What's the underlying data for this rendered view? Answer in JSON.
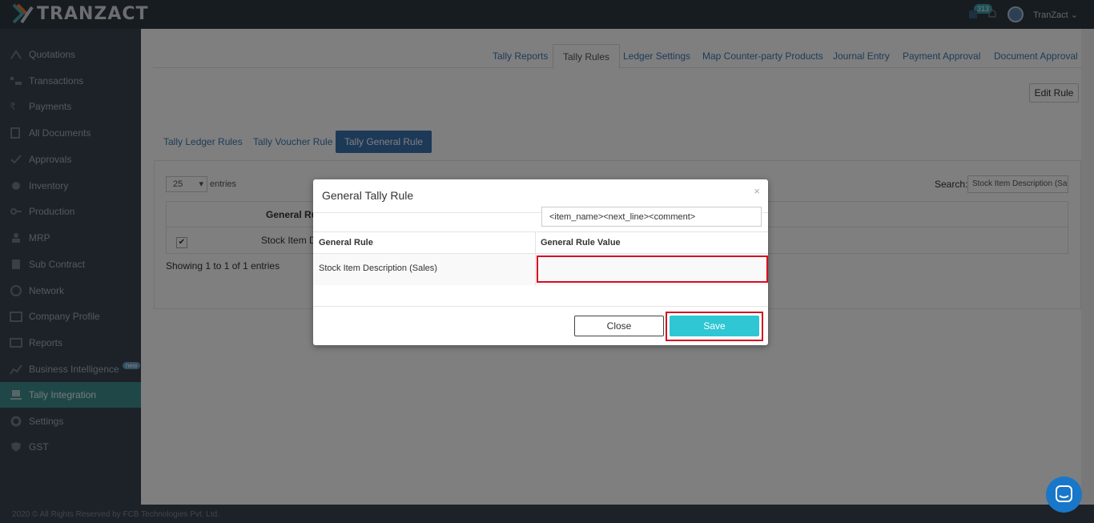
{
  "app": {
    "brand": "TRANZACT",
    "notification_count": "313",
    "user_name": "TranZact"
  },
  "sidebar": {
    "items": [
      {
        "label": "Quotations",
        "icon": "quotation-icon"
      },
      {
        "label": "Transactions",
        "icon": "transaction-icon"
      },
      {
        "label": "Payments",
        "icon": "rupee-icon"
      },
      {
        "label": "All Documents",
        "icon": "documents-icon"
      },
      {
        "label": "Approvals",
        "icon": "approval-icon"
      },
      {
        "label": "Inventory",
        "icon": "inventory-icon"
      },
      {
        "label": "Production",
        "icon": "production-icon"
      },
      {
        "label": "MRP",
        "icon": "mrp-icon"
      },
      {
        "label": "Sub Contract",
        "icon": "subcontract-icon"
      },
      {
        "label": "Network",
        "icon": "network-icon"
      },
      {
        "label": "Company Profile",
        "icon": "company-icon"
      },
      {
        "label": "Reports",
        "icon": "reports-icon"
      },
      {
        "label": "Business Intelligence",
        "icon": "chart-icon",
        "badge": "new"
      },
      {
        "label": "Tally Integration",
        "icon": "tally-icon",
        "active": true
      },
      {
        "label": "Settings",
        "icon": "gear-icon"
      },
      {
        "label": "GST",
        "icon": "gst-icon"
      }
    ]
  },
  "tabs": [
    "Tally Reports",
    "Tally Rules",
    "Ledger Settings",
    "Map Counter-party Products",
    "Journal Entry",
    "Payment Approval",
    "Document Approval"
  ],
  "active_tab": "Tally Rules",
  "edit_rule_label": "Edit Rule",
  "subtabs": [
    "Tally Ledger Rules",
    "Tally Voucher Rule",
    "Tally General Rule"
  ],
  "active_subtab": "Tally General Rule",
  "table_controls": {
    "entries_value": "25",
    "entries_label": "entries",
    "search_label": "Search:",
    "search_value": "Stock Item Description (Sa",
    "column_header": "General Ru",
    "row_cell": "Stock Item De",
    "showing_text": "Showing 1 to 1 of 1 entries"
  },
  "modal": {
    "title": "General Tally Rule",
    "close_glyph": "×",
    "col1_header": "General Rule",
    "col2_header": "General Rule Value",
    "row_rule": "Stock Item Description (Sales)",
    "row_value": "<item_name><next_line><comment>",
    "close_label": "Close",
    "save_label": "Save"
  },
  "footer": {
    "text": "2020 © All Rights Reserved by FCB Technologies Pvt. Ltd."
  },
  "colors": {
    "accent": "#2ec7d3",
    "highlight": "#d6101f",
    "sidebar_active": "#3e8f91",
    "subtab_active": "#3b72b1"
  }
}
